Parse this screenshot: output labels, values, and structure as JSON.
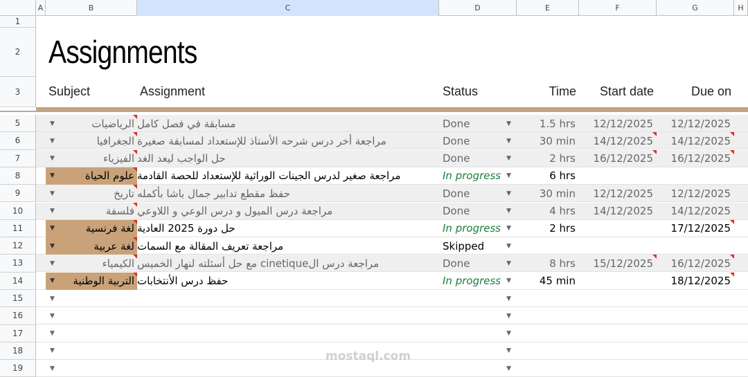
{
  "columns": [
    "A",
    "B",
    "C",
    "D",
    "E",
    "F",
    "G",
    "H"
  ],
  "row_numbers": [
    "1",
    "2",
    "3",
    "5",
    "6",
    "7",
    "8",
    "9",
    "10",
    "11",
    "12",
    "13",
    "14",
    "15",
    "16",
    "17",
    "18",
    "19"
  ],
  "title": "Assignments",
  "headers": {
    "subject": "Subject",
    "assignment": "Assignment",
    "status": "Status",
    "time": "Time",
    "start": "Start date",
    "due": "Due on"
  },
  "colors": {
    "accent": "#c9a27a",
    "in_progress": "#188038",
    "done_bg": "#efefef"
  },
  "rows": [
    {
      "subject": "الرياضيات",
      "assignment": "مسابقة في فصل كامل",
      "status": "Done",
      "time": "1.5 hrs",
      "start": "12/12/2025",
      "due": "12/12/2025",
      "sf": false,
      "df": false
    },
    {
      "subject": "الجغرافيا",
      "assignment": "مراجعة أخر درس شرحه الأستاذ للإستعداد لمسابقة صغيرة",
      "status": "Done",
      "time": "30 min",
      "start": "14/12/2025",
      "due": "14/12/2025",
      "sf": true,
      "df": true
    },
    {
      "subject": "الفيزياء",
      "assignment": "حل الواجب ليعد الغد",
      "status": "Done",
      "time": "2 hrs",
      "start": "16/12/2025",
      "due": "16/12/2025",
      "sf": true,
      "df": true
    },
    {
      "subject": "علوم الحياة",
      "assignment": "مراجعة صغير لدرس الجينات الوراثية للإستعداد للحصة القادمة",
      "status": "In progress",
      "time": "6 hrs",
      "start": "",
      "due": "",
      "sf": false,
      "df": false
    },
    {
      "subject": "تاريخ",
      "assignment": "حفظ مقطع تدابير جمال باشا بأكمله",
      "status": "Done",
      "time": "30 min",
      "start": "12/12/2025",
      "due": "12/12/2025",
      "sf": false,
      "df": false
    },
    {
      "subject": "فلسفة",
      "assignment": "مراجعة درس الميول و درس الوعي و اللاوعي",
      "status": "Done",
      "time": "4 hrs",
      "start": "14/12/2025",
      "due": "14/12/2025",
      "sf": false,
      "df": false
    },
    {
      "subject": "لغة فرنسية",
      "assignment": "حل دورة 2025 العادية",
      "status": "In progress",
      "time": "2 hrs",
      "start": "",
      "due": "17/12/2025",
      "sf": false,
      "df": true
    },
    {
      "subject": "لغة عربية",
      "assignment": "مراجعة تعريف المقالة مع السمات",
      "status": "Skipped",
      "time": "",
      "start": "",
      "due": "",
      "sf": false,
      "df": false
    },
    {
      "subject": "الكيمياء",
      "assignment": "مراجعة درس الcinetique مع حل أسئلته لنهار الخميس",
      "status": "Done",
      "time": "8 hrs",
      "start": "15/12/2025",
      "due": "16/12/2025",
      "sf": true,
      "df": true
    },
    {
      "subject": "التربية الوطنية",
      "assignment": "حفظ درس الأنتخابات",
      "status": "In progress",
      "time": "45 min",
      "start": "",
      "due": "18/12/2025",
      "sf": false,
      "df": true
    }
  ],
  "watermark": "mostaql.com"
}
